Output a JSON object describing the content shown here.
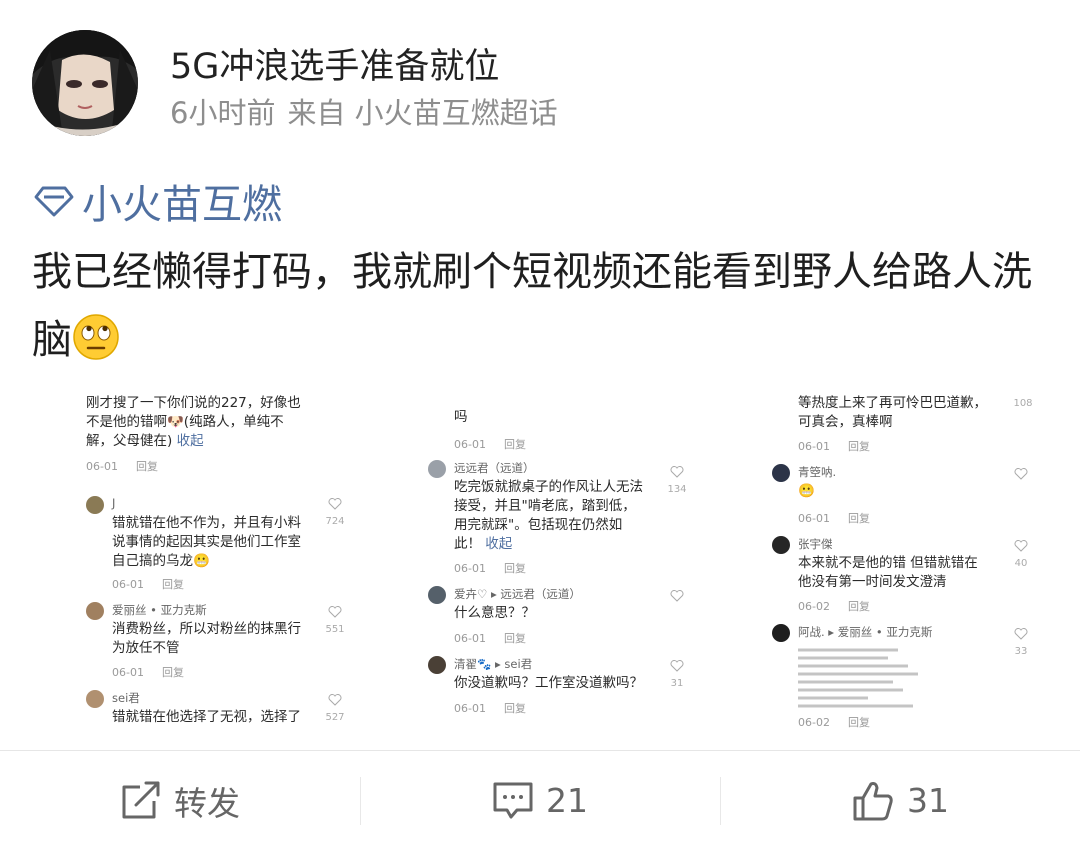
{
  "post": {
    "username": "5G冲浪选手准备就位",
    "time": "6小时前",
    "source": "来自 小火苗互燃超话",
    "topic": "小火苗互燃",
    "text": "我已经懒得打码，我就刷个短视频还能看到野人给路人洗脑",
    "emoji": "eye-roll-emoji"
  },
  "screenshots": [
    {
      "comments": [
        {
          "user": "",
          "lines": [
            "刚才搜了一下你们说的227，好像也",
            "不是他的错啊🐶(纯路人，单纯不",
            "解，父母健在)"
          ],
          "collapse": "收起",
          "date": "06-01",
          "reply": "回复",
          "likes": ""
        },
        {
          "user": "J",
          "lines": [
            "错就错在他不作为，并且有小料",
            "说事情的起因其实是他们工作室",
            "自己搞的乌龙😬"
          ],
          "date": "06-01",
          "reply": "回复",
          "likes": "724"
        },
        {
          "user": "爱丽丝 • 亚力克斯",
          "lines": [
            "消费粉丝，所以对粉丝的抹黑行",
            "为放任不管"
          ],
          "date": "06-01",
          "reply": "回复",
          "likes": "551"
        },
        {
          "user": "sei君",
          "lines": [
            "错就错在他选择了无视，选择了"
          ],
          "date": "",
          "reply": "",
          "likes": "527"
        }
      ]
    },
    {
      "comments": [
        {
          "user": "",
          "lines": [
            "吗"
          ],
          "date": "06-01",
          "reply": "回复",
          "likes": ""
        },
        {
          "user": "远远君（远道）",
          "lines": [
            "吃完饭就掀桌子的作风让人无法",
            "接受，并且\"啃老底，踏到低，",
            "用完就踩\"。包括现在仍然如",
            "此！"
          ],
          "collapse": "收起",
          "date": "06-01",
          "reply": "回复",
          "likes": "134"
        },
        {
          "user": "爱卉♡ ▸ 远远君（远道）",
          "lines": [
            "什么意思？？"
          ],
          "date": "06-01",
          "reply": "回复",
          "likes": ""
        },
        {
          "user": "清翟🐾 ▸ sei君",
          "lines": [
            "你没道歉吗？工作室没道歉吗？"
          ],
          "date": "06-01",
          "reply": "回复",
          "likes": "31"
        }
      ]
    },
    {
      "comments": [
        {
          "user": "",
          "lines": [
            "等热度上来了再可怜巴巴道歉，",
            "可真会，真棒啊"
          ],
          "date": "06-01",
          "reply": "回复",
          "likes": "108"
        },
        {
          "user": "青箜呐.",
          "lines": [
            "😬"
          ],
          "date": "06-01",
          "reply": "回复",
          "likes": ""
        },
        {
          "user": "张宇傑",
          "lines": [
            "本来就不是他的错 但错就错在",
            "他没有第一时间发文澄清"
          ],
          "date": "06-02",
          "reply": "回复",
          "likes": "40"
        },
        {
          "user": "阿战. ▸ 爱丽丝 • 亚力克斯",
          "lines": [],
          "date": "06-02",
          "reply": "回复",
          "likes": "33"
        }
      ]
    }
  ],
  "actions": {
    "repost": "转发",
    "comments": "21",
    "likes": "31"
  },
  "colors": {
    "topic": "#4f6fa0",
    "text": "#1f1f1f",
    "meta": "#8e8e8e"
  }
}
